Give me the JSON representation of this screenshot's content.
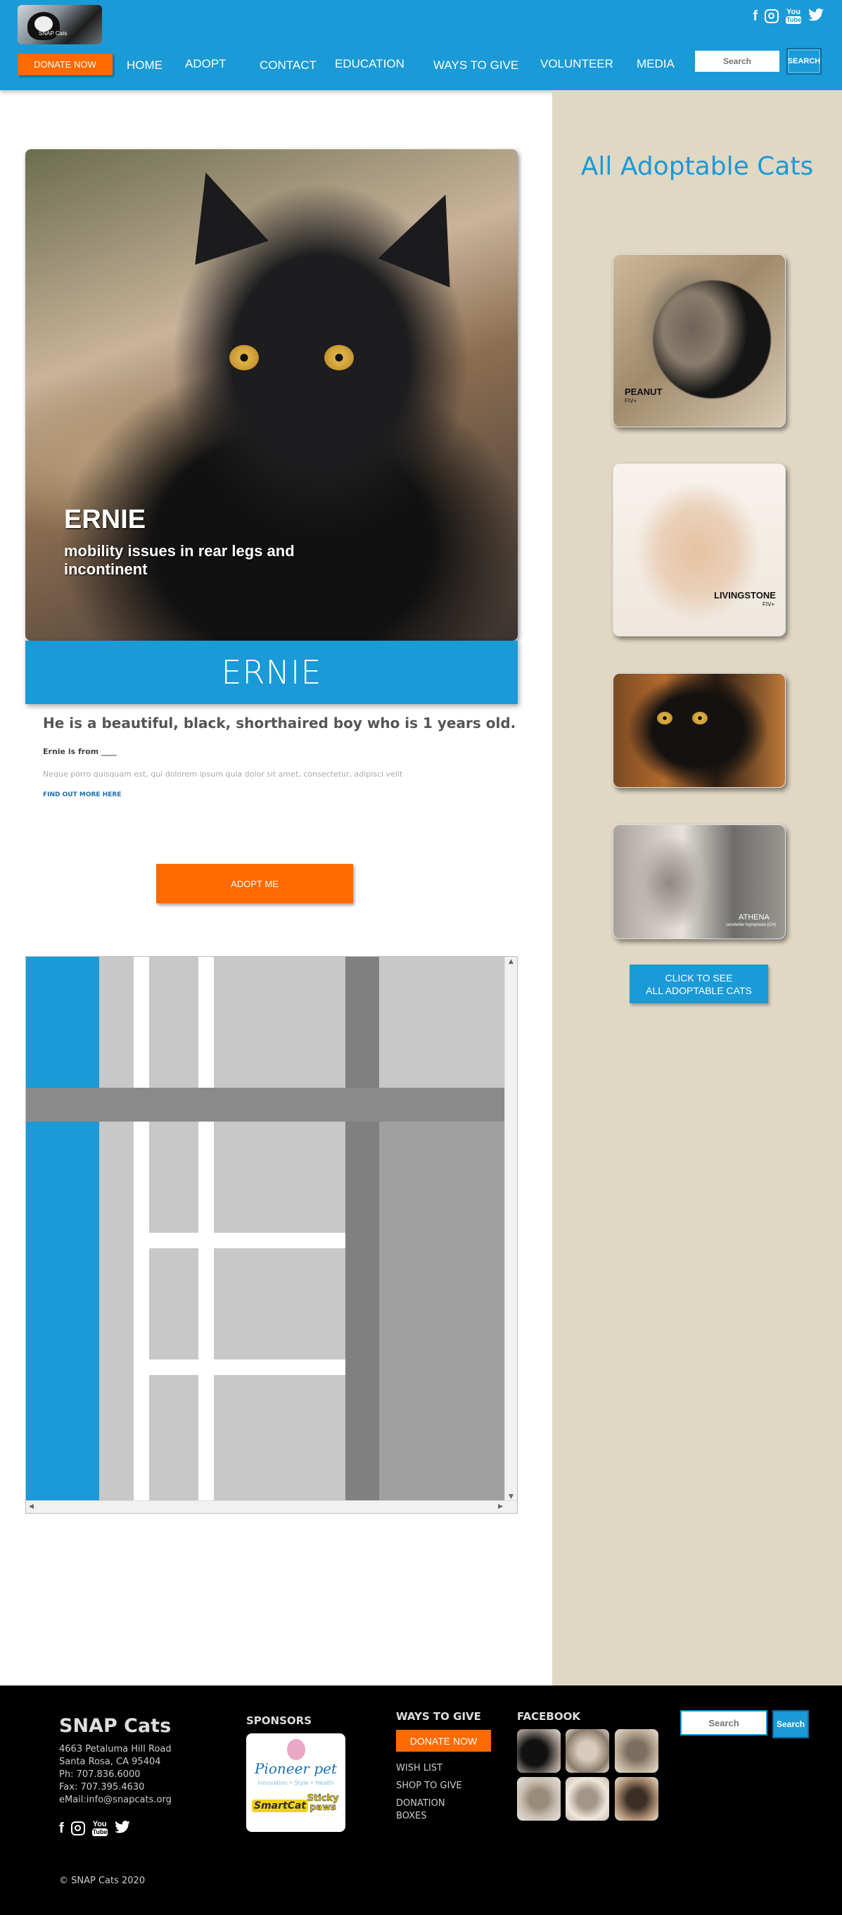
{
  "header": {
    "logo_text": "SNAP Cats",
    "social": [
      "facebook-icon",
      "instagram-icon",
      "youtube-icon",
      "twitter-icon"
    ],
    "donate_label": "DONATE NOW",
    "nav": [
      "HOME",
      "ADOPT",
      "CONTACT",
      "EDUCATION",
      "WAYS TO GIVE",
      "VOLUNTEER",
      "MEDIA"
    ],
    "search_placeholder": "Search",
    "search_button": "SEARCH"
  },
  "hero": {
    "name": "ERNIE",
    "description": "mobility issues in rear legs and incontinent",
    "name_bar": "ERNIE"
  },
  "profile": {
    "intro": "He is a beautiful, black, shorthaired boy who is 1 years old.",
    "from": "Ernie is from ____",
    "lorem": "Neque porro quisquam est, qui dolorem ipsum quia dolor sit amet, consectetur, adipisci velit",
    "find_more": "FIND OUT MORE HERE",
    "adopt_button": "ADOPT ME"
  },
  "sidebar": {
    "title": "All Adoptable Cats",
    "cats": [
      {
        "name": "PEANUT",
        "note": "FIV+"
      },
      {
        "name": "LIVINGSTONE",
        "note": "FIV+"
      },
      {
        "name": "",
        "note": ""
      },
      {
        "name": "ATHENA",
        "note": "cerebellar hypoplasia (CH)"
      }
    ],
    "cta_line1": "CLICK TO SEE",
    "cta_line2": "ALL ADOPTABLE CATS"
  },
  "footer": {
    "title": "SNAP Cats",
    "address": [
      "4663 Petaluma Hill Road",
      "Santa Rosa, CA 95404",
      "Ph: 707.836.6000",
      "Fax: 707.395.4630",
      "eMail:info@snapcats.org"
    ],
    "sponsors_heading": "SPONSORS",
    "sponsor_name": "Pioneer pet",
    "sponsor_tagline": "Innovation • Style • Health",
    "sponsor_brand1": "SmartCat",
    "sponsor_brand2": "Sticky paws",
    "ways_heading": "WAYS TO GIVE",
    "donate_label": "DONATE NOW",
    "links": [
      "WISH LIST",
      "SHOP TO GIVE",
      "DONATION BOXES"
    ],
    "facebook_heading": "FACEBOOK",
    "search_placeholder": "Search",
    "search_button": "Search",
    "copyright": "© SNAP Cats 2020"
  },
  "colors": {
    "brand_blue": "#1a9ad6",
    "accent_orange": "#ff6a00",
    "sidebar_bg": "#e1d8c4",
    "footer_bg": "#000000"
  }
}
